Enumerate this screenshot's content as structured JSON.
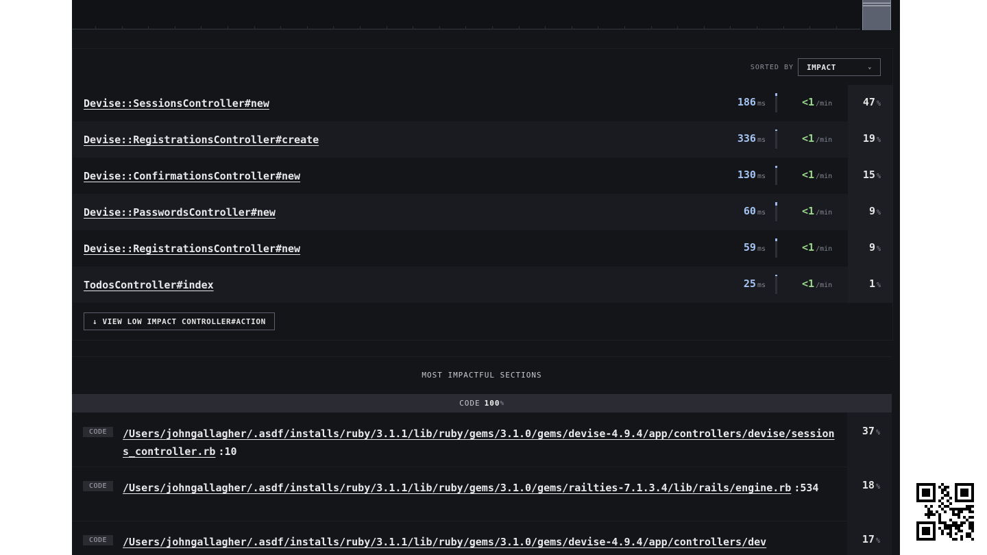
{
  "sort": {
    "label": "SORTED BY",
    "value": "IMPACT"
  },
  "controllers": [
    {
      "name": "Devise::SessionsController#new",
      "ms": "186",
      "ms_unit": "ms",
      "bar_fraction": 0.15,
      "throughput": "<1",
      "tp_unit": "/min",
      "impact": "47",
      "impact_unit": "%"
    },
    {
      "name": "Devise::RegistrationsController#create",
      "ms": "336",
      "ms_unit": "ms",
      "bar_fraction": 0.05,
      "throughput": "<1",
      "tp_unit": "/min",
      "impact": "19",
      "impact_unit": "%"
    },
    {
      "name": "Devise::ConfirmationsController#new",
      "ms": "130",
      "ms_unit": "ms",
      "bar_fraction": 0.12,
      "throughput": "<1",
      "tp_unit": "/min",
      "impact": "15",
      "impact_unit": "%"
    },
    {
      "name": "Devise::PasswordsController#new",
      "ms": "60",
      "ms_unit": "ms",
      "bar_fraction": 0.18,
      "throughput": "<1",
      "tp_unit": "/min",
      "impact": "9",
      "impact_unit": "%"
    },
    {
      "name": "Devise::RegistrationsController#new",
      "ms": "59",
      "ms_unit": "ms",
      "bar_fraction": 0.14,
      "throughput": "<1",
      "tp_unit": "/min",
      "impact": "9",
      "impact_unit": "%"
    },
    {
      "name": "TodosController#index",
      "ms": "25",
      "ms_unit": "ms",
      "bar_fraction": 0.06,
      "throughput": "<1",
      "tp_unit": "/min",
      "impact": "1",
      "impact_unit": "%"
    }
  ],
  "low_impact_button": "↓ VIEW LOW IMPACT CONTROLLER#ACTION",
  "sections": {
    "title": "MOST IMPACTFUL SECTIONS",
    "summary_label": "CODE",
    "summary_value": "100",
    "summary_unit": "%",
    "items": [
      {
        "tag": "CODE",
        "path": "/Users/johngallagher/.asdf/installs/ruby/3.1.1/lib/ruby/gems/3.1.0/gems/devise-4.9.4/app/controllers/devise/sessions_controller.rb",
        "line": ":10",
        "impact": "37",
        "impact_unit": "%"
      },
      {
        "tag": "CODE",
        "path": "/Users/johngallagher/.asdf/installs/ruby/3.1.1/lib/ruby/gems/3.1.0/gems/railties-7.1.3.4/lib/rails/engine.rb",
        "line": ":534",
        "impact": "18",
        "impact_unit": "%"
      },
      {
        "tag": "CODE",
        "path": "/Users/johngallagher/.asdf/installs/ruby/3.1.1/lib/ruby/gems/3.1.0/gems/devise-4.9.4/app/controllers/dev",
        "line": "",
        "impact": "17",
        "impact_unit": "%"
      }
    ]
  },
  "icons": {
    "sort_chevron": "chevron-down-icon",
    "qr": "qr-code-icon"
  }
}
